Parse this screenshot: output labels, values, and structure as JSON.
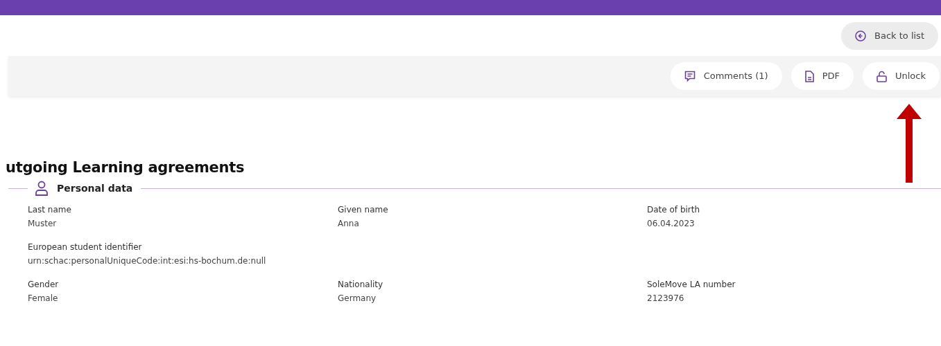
{
  "header": {
    "back_button": "Back to list"
  },
  "toolbar": {
    "buttons": [
      {
        "kind": "comments",
        "label": "Comments (1)"
      },
      {
        "kind": "pdf",
        "label": "PDF"
      },
      {
        "kind": "unlock",
        "label": "Unlock"
      }
    ]
  },
  "page_title": "utgoing Learning agreements",
  "section": {
    "title": "Personal data",
    "rows": [
      [
        {
          "label": "Last name",
          "value": "Muster"
        },
        {
          "label": "Given name",
          "value": "Anna"
        },
        {
          "label": "Date of birth",
          "value": "06.04.2023"
        }
      ],
      [
        {
          "label": "European student identifier",
          "value": "urn:schac:personalUniqueCode:int:esi:hs-bochum.de:null"
        }
      ],
      [
        {
          "label": "Gender",
          "value": "Female"
        },
        {
          "label": "Nationality",
          "value": "Germany"
        },
        {
          "label": "SoleMove LA number",
          "value": "2123976"
        }
      ]
    ]
  }
}
